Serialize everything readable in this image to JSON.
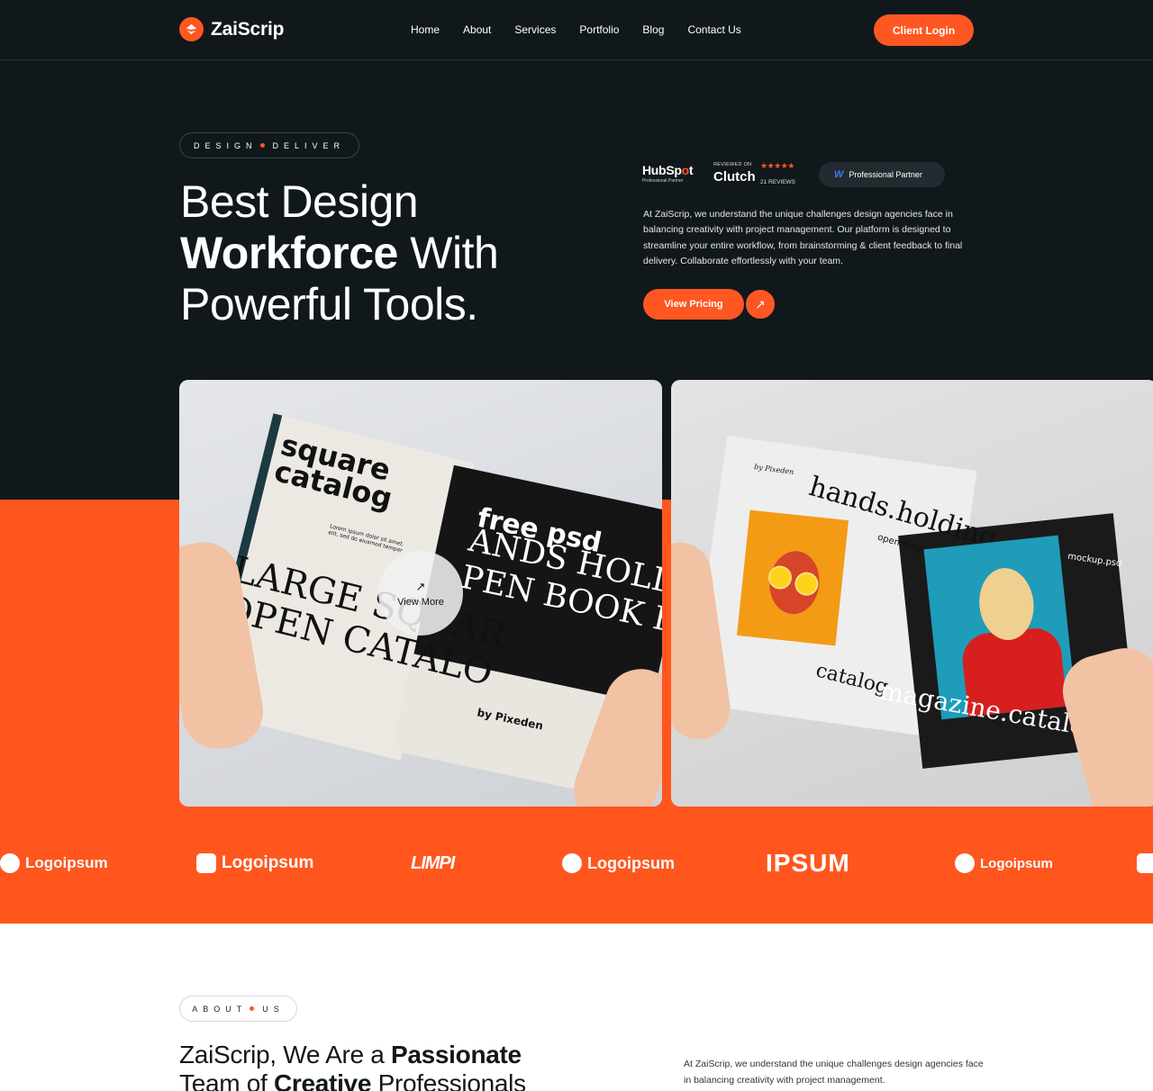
{
  "brand": {
    "name": "ZaiScrip",
    "accent": "#ff5722",
    "dark": "#11181c"
  },
  "nav": {
    "links": [
      "Home",
      "About",
      "Services",
      "Portfolio",
      "Blog",
      "Contact Us"
    ],
    "login_label": "Client Login"
  },
  "hero": {
    "pill_left": "DESIGN",
    "pill_right": "DELIVER",
    "title_line1": "Best Design",
    "title_bold": "Workforce",
    "title_line2_rest": " With",
    "title_line3": "Powerful Tools.",
    "description": "At ZaiScrip, we understand the unique challenges design agencies face in balancing creativity with project management. Our platform is designed to streamline your entire workflow, from brainstorming & client feedback to final delivery. Collaborate effortlessly with your team.",
    "cta_label": "View Pricing",
    "badges": {
      "hubspot_name_a": "HubSp",
      "hubspot_name_o": "o",
      "hubspot_name_b": "t",
      "hubspot_sub": "Professional Partner",
      "clutch_reviewed": "REVIEWED ON",
      "clutch_stars": "★★★★★",
      "clutch_name": "Clutch",
      "clutch_count": "21 REVIEWS",
      "partner_label": "Professional Partner"
    }
  },
  "gallery": {
    "view_more_label": "View More",
    "card1": {
      "title1": "square",
      "title2": "catalog",
      "big1": "LARGE SQUAR",
      "big2": "OPEN CATALO",
      "right1": "free psd",
      "right2": "ANDS HOLD",
      "right3": "PEN   BOOK F",
      "credit": "by Pixeden",
      "lorem": "Lorem ipsum dolor sit amet, elit, sed do eiusmod tempor"
    },
    "card2": {
      "byline": "by Pixeden",
      "title": "hands.holding",
      "sub": "open.magazine",
      "catalog": "catalog",
      "mockup": "mockup.psd",
      "magazine": "magazine.catalog"
    }
  },
  "partners": [
    "Logoipsum",
    "Logoipsum",
    "LIMPI",
    "Logoipsum",
    "IPSUM",
    "Logoipsum"
  ],
  "about": {
    "pill_left": "ABOUT",
    "pill_right": "US",
    "title_a": "ZaiScrip, We Are a ",
    "title_bold1": "Passionate",
    "title_b": "Team of ",
    "title_bold2": "Creative",
    "title_c": " Professionals",
    "description": "At ZaiScrip, we understand the unique challenges design agencies face in balancing creativity with project management."
  }
}
